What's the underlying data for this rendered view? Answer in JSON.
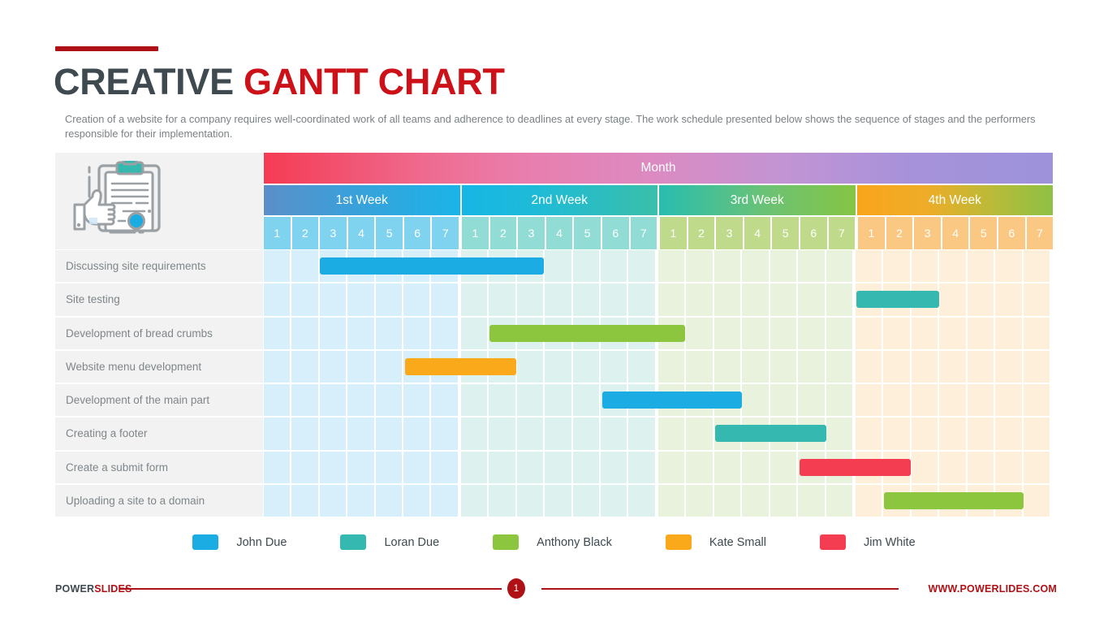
{
  "header": {
    "title_part1": "CREATIVE ",
    "title_part2": "GANTT CHART",
    "subtitle": "Creation of a website for a company requires well-coordinated work of all teams and adherence to deadlines at every stage. The work schedule presented below shows the sequence of stages and the performers responsible for their implementation."
  },
  "chart_header": {
    "month_label": "Month",
    "weeks": [
      "1st Week",
      "2nd Week",
      "3rd Week",
      "4th Week"
    ],
    "days": [
      "1",
      "2",
      "3",
      "4",
      "5",
      "6",
      "7"
    ]
  },
  "icon": {
    "name": "clipboard-thumbs-up-icon"
  },
  "tasks": [
    {
      "label": "Discussing site requirements",
      "owner": "John Due",
      "color": "#1CACE4",
      "start_col": 2,
      "span": 8
    },
    {
      "label": "Site testing",
      "owner": "Loran Due",
      "color": "#35B8AF",
      "start_col": 21,
      "span": 3
    },
    {
      "label": "Development of bread crumbs",
      "owner": "Anthony Black",
      "color": "#8CC63E",
      "start_col": 8,
      "span": 7
    },
    {
      "label": "Website menu development",
      "owner": "Kate Small",
      "color": "#FAA91B",
      "start_col": 5,
      "span": 4
    },
    {
      "label": "Development of the main part",
      "owner": "John Due",
      "color": "#1CACE4",
      "start_col": 12,
      "span": 5
    },
    {
      "label": "Creating a footer",
      "owner": "Loran Due",
      "color": "#35B8AF",
      "start_col": 16,
      "span": 4
    },
    {
      "label": "Create a submit form",
      "owner": "Jim White",
      "color": "#F43D51",
      "start_col": 19,
      "span": 4
    },
    {
      "label": "Uploading a site to a domain",
      "owner": "Anthony Black",
      "color": "#8CC63E",
      "start_col": 22,
      "span": 5
    }
  ],
  "legend": [
    {
      "label": "John Due",
      "color": "#1CACE4"
    },
    {
      "label": "Loran Due",
      "color": "#35B8AF"
    },
    {
      "label": "Anthony Black",
      "color": "#8CC63E"
    },
    {
      "label": "Kate Small",
      "color": "#FAA91B"
    },
    {
      "label": "Jim White",
      "color": "#F43D51"
    }
  ],
  "footer": {
    "brand_part1": "POWER",
    "brand_part2": "SLIDES",
    "page_number": "1",
    "url": "WWW.POWERLIDES.COM"
  },
  "colors": {
    "accent_red": "#B01116",
    "title_red": "#CC1119",
    "title_dark": "#3E4A4F"
  },
  "chart_data": {
    "type": "bar",
    "title": "CREATIVE GANTT CHART",
    "xlabel": "Month",
    "ylabel": "",
    "x_groups": [
      "1st Week",
      "2nd Week",
      "3rd Week",
      "4th Week"
    ],
    "x_ticks": [
      "1",
      "2",
      "3",
      "4",
      "5",
      "6",
      "7",
      "1",
      "2",
      "3",
      "4",
      "5",
      "6",
      "7",
      "1",
      "2",
      "3",
      "4",
      "5",
      "6",
      "7",
      "1",
      "2",
      "3",
      "4",
      "5",
      "6",
      "7"
    ],
    "xlim": [
      1,
      28
    ],
    "grid": true,
    "legend_position": "bottom",
    "categories": [
      "Discussing site requirements",
      "Site testing",
      "Development of bread crumbs",
      "Website menu development",
      "Development of the main part",
      "Creating a footer",
      "Create a submit form",
      "Uploading a site to a domain"
    ],
    "series": [
      {
        "name": "John Due",
        "color": "#1CACE4",
        "values": [
          [
            3,
            10
          ],
          null,
          null,
          null,
          [
            13,
            17
          ],
          null,
          null,
          null
        ]
      },
      {
        "name": "Loran Due",
        "color": "#35B8AF",
        "values": [
          null,
          [
            22,
            24
          ],
          null,
          null,
          null,
          [
            17,
            20
          ],
          null,
          null
        ]
      },
      {
        "name": "Anthony Black",
        "color": "#8CC63E",
        "values": [
          null,
          null,
          [
            9,
            15
          ],
          null,
          null,
          null,
          null,
          [
            23,
            27
          ]
        ]
      },
      {
        "name": "Kate Small",
        "color": "#FAA91B",
        "values": [
          null,
          null,
          null,
          [
            6,
            9
          ],
          null,
          null,
          null,
          null
        ]
      },
      {
        "name": "Jim White",
        "color": "#F43D51",
        "values": [
          null,
          null,
          null,
          null,
          null,
          null,
          [
            20,
            23
          ],
          null
        ]
      }
    ],
    "annotations": "Bar extents are given as [start_day_index, end_day_index] over a 28-day month (1-based, inclusive start)."
  }
}
